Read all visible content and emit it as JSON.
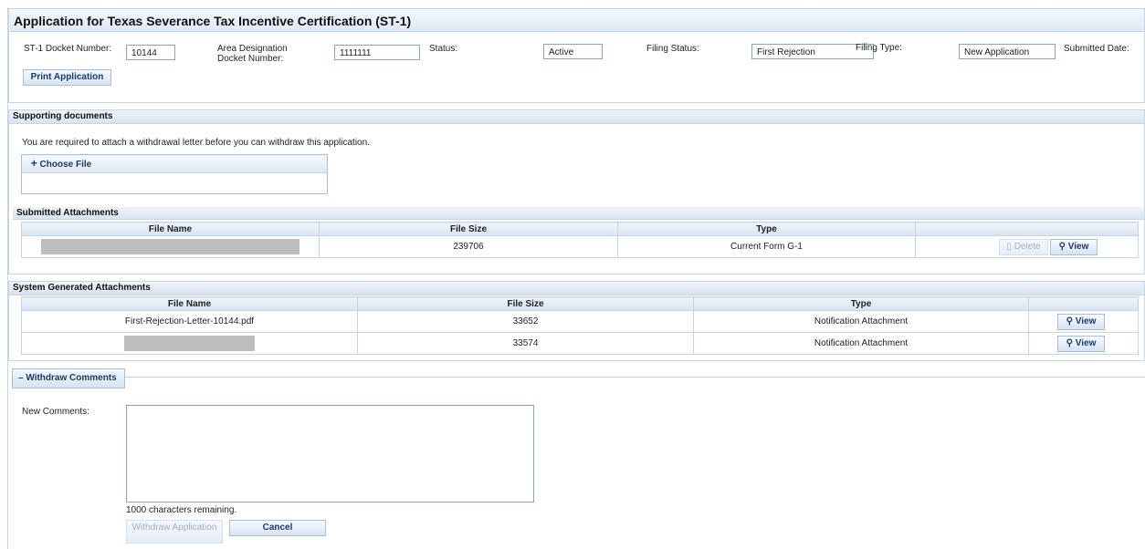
{
  "page_title": "Application for Texas Severance Tax Incentive Certification (ST-1)",
  "header": {
    "docket_label": "ST-1 Docket Number:",
    "docket_value": "10144",
    "area_label": "Area Designation Docket Number:",
    "area_value": "1111111",
    "status_label": "Status:",
    "status_value": "Active",
    "filing_status_label": "Filing Status:",
    "filing_status_value": "First Rejection",
    "filing_type_label": "Filing Type:",
    "filing_type_value": "New Application",
    "submitted_label": "Submitted Date:",
    "print_button": "Print Application"
  },
  "supporting": {
    "title": "Supporting documents",
    "notice": "You are required to attach a withdrawal letter before you can withdraw this application.",
    "choose_file": "Choose File"
  },
  "submitted_attachments": {
    "title": "Submitted Attachments",
    "columns": [
      "File Name",
      "File Size",
      "Type",
      ""
    ],
    "rows": [
      {
        "file_name": "",
        "size": "239706",
        "type": "Current Form G-1",
        "delete": "Delete",
        "view": "View"
      }
    ]
  },
  "system_attachments": {
    "title": "System Generated Attachments",
    "columns": [
      "File Name",
      "File Size",
      "Type",
      ""
    ],
    "rows": [
      {
        "file_name": "First-Rejection-Letter-10144.pdf",
        "size": "33652",
        "type": "Notification Attachment",
        "view": "View"
      },
      {
        "file_name": "",
        "size": "33574",
        "type": "Notification Attachment",
        "view": "View"
      }
    ]
  },
  "withdraw": {
    "legend": "Withdraw Comments",
    "comments_label": "New Comments:",
    "comments_value": "",
    "chars_remaining": "1000 characters remaining.",
    "withdraw_button": "Withdraw Application",
    "cancel_button": "Cancel"
  },
  "icons": {
    "plus": "plus-icon",
    "minus": "minus-icon",
    "view": "magnifier-icon",
    "delete": "trash-icon"
  }
}
